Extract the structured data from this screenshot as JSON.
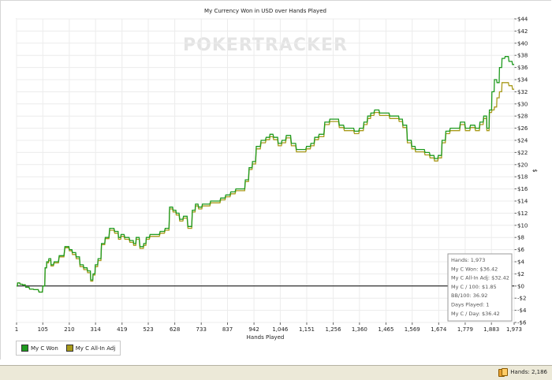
{
  "chart_data": {
    "type": "line",
    "title": "My Currency Won in USD over Hands Played",
    "watermark": "POKERTRACKER",
    "xlabel": "Hands Played",
    "ylabel": "$",
    "xlim": [
      1,
      1973
    ],
    "ylim": [
      -6,
      44
    ],
    "x_ticks": [
      "1",
      "105",
      "210",
      "314",
      "419",
      "523",
      "628",
      "733",
      "837",
      "942",
      "1,046",
      "1,151",
      "1,256",
      "1,360",
      "1,465",
      "1,569",
      "1,674",
      "1,779",
      "1,883",
      "1,973"
    ],
    "y_ticks": [
      "-$6",
      "-$4",
      "-$2",
      "$0",
      "$2",
      "$4",
      "$6",
      "$8",
      "$10",
      "$12",
      "$14",
      "$16",
      "$18",
      "$20",
      "$22",
      "$24",
      "$26",
      "$28",
      "$30",
      "$32",
      "$34",
      "$36",
      "$38",
      "$40",
      "$42",
      "$44"
    ],
    "grid": true,
    "legend_position": "bottom-left",
    "series": [
      {
        "name": "My C Won",
        "color": "#1e9a1e",
        "x": [
          1,
          10,
          20,
          30,
          45,
          60,
          80,
          100,
          110,
          118,
          123,
          135,
          140,
          160,
          180,
          205,
          215,
          230,
          245,
          260,
          275,
          290,
          300,
          308,
          318,
          330,
          345,
          360,
          380,
          400,
          410,
          420,
          440,
          460,
          470,
          480,
          500,
          510,
          520,
          540,
          560,
          580,
          600,
          615,
          628,
          640,
          655,
          670,
          690,
          705,
          715,
          730,
          745,
          760,
          780,
          800,
          820,
          840,
          860,
          880,
          900,
          915,
          930,
          942,
          960,
          980,
          1000,
          1010,
          1030,
          1046,
          1060,
          1080,
          1100,
          1120,
          1140,
          1160,
          1175,
          1190,
          1210,
          1235,
          1250,
          1270,
          1290,
          1310,
          1330,
          1350,
          1370,
          1385,
          1400,
          1410,
          1430,
          1450,
          1470,
          1490,
          1510,
          1525,
          1540,
          1560,
          1575,
          1590,
          1610,
          1630,
          1650,
          1665,
          1680,
          1695,
          1710,
          1730,
          1750,
          1770,
          1790,
          1810,
          1830,
          1845,
          1860,
          1870,
          1880,
          1890,
          1900,
          1910,
          1920,
          1930,
          1945,
          1960,
          1973
        ],
        "y": [
          0,
          0.5,
          0.3,
          0.2,
          -0.2,
          -0.5,
          -0.6,
          -1,
          0,
          3,
          4,
          4.5,
          3.5,
          4,
          5,
          6.5,
          6,
          5.5,
          4.8,
          3.5,
          3,
          2.5,
          1,
          2,
          3.5,
          4.5,
          7,
          8,
          9.5,
          9,
          8,
          8.5,
          8,
          7.5,
          7,
          8,
          6.5,
          7,
          8,
          8.5,
          8.5,
          9,
          9.5,
          13,
          12.5,
          12,
          11,
          11.5,
          9.8,
          12.5,
          13.5,
          13,
          13.5,
          13.5,
          14,
          14,
          14.5,
          15,
          15.5,
          16,
          16,
          17.5,
          19.5,
          20.5,
          23,
          24,
          24.5,
          25,
          24.5,
          23.5,
          24,
          24.8,
          23.5,
          22.5,
          22.5,
          23,
          23.5,
          24.5,
          25,
          27,
          27.5,
          27.5,
          26.5,
          26,
          26,
          25.5,
          26,
          27,
          28,
          28.5,
          29,
          28.5,
          28.5,
          28,
          28,
          27.5,
          26.5,
          24,
          23,
          22.5,
          22.5,
          22,
          21.5,
          21,
          21.5,
          24,
          25.5,
          26,
          26,
          27,
          26,
          26.5,
          26,
          27,
          28,
          26,
          29,
          32,
          34,
          33.5,
          36,
          37.5,
          37.8,
          37,
          36.5
        ]
      },
      {
        "name": "My C All-In Adj",
        "color": "#a89a1a",
        "x": [
          1,
          10,
          20,
          30,
          45,
          60,
          80,
          100,
          110,
          118,
          123,
          135,
          140,
          160,
          180,
          205,
          215,
          230,
          245,
          260,
          275,
          290,
          300,
          308,
          318,
          330,
          345,
          360,
          380,
          400,
          410,
          420,
          440,
          460,
          470,
          480,
          500,
          510,
          520,
          540,
          560,
          580,
          600,
          615,
          628,
          640,
          655,
          670,
          690,
          705,
          715,
          730,
          745,
          760,
          780,
          800,
          820,
          840,
          860,
          880,
          900,
          915,
          930,
          942,
          960,
          980,
          1000,
          1010,
          1030,
          1046,
          1060,
          1080,
          1100,
          1120,
          1140,
          1160,
          1175,
          1190,
          1210,
          1235,
          1250,
          1270,
          1290,
          1310,
          1330,
          1350,
          1370,
          1385,
          1400,
          1410,
          1430,
          1450,
          1470,
          1490,
          1510,
          1525,
          1540,
          1560,
          1575,
          1590,
          1610,
          1630,
          1650,
          1665,
          1680,
          1695,
          1710,
          1730,
          1750,
          1770,
          1790,
          1810,
          1830,
          1845,
          1860,
          1870,
          1880,
          1890,
          1900,
          1910,
          1920,
          1930,
          1945,
          1960,
          1973
        ],
        "y": [
          0,
          0.5,
          0.3,
          0.2,
          -0.2,
          -0.5,
          -0.6,
          -1,
          0,
          3,
          3.8,
          4.2,
          3.3,
          3.8,
          4.8,
          6.3,
          5.8,
          5.2,
          4.5,
          3.2,
          2.7,
          2.2,
          0.8,
          1.8,
          3.2,
          4.2,
          6.8,
          7.8,
          9.2,
          8.7,
          7.7,
          8.2,
          7.7,
          7.2,
          6.7,
          7.7,
          6.2,
          6.7,
          7.7,
          8.2,
          8.2,
          8.7,
          9.2,
          12.7,
          12.2,
          11.7,
          10.7,
          11.2,
          9.5,
          12.2,
          13.2,
          12.7,
          13.2,
          13.2,
          13.7,
          13.7,
          14.2,
          14.7,
          15.2,
          15.7,
          15.7,
          17.2,
          19.2,
          20.1,
          22.6,
          23.6,
          24.1,
          24.6,
          24.1,
          23.1,
          23.6,
          24.4,
          23.1,
          22.1,
          22.1,
          22.6,
          23.1,
          24.1,
          24.6,
          26.6,
          27.1,
          27.1,
          26.1,
          25.6,
          25.6,
          25.1,
          25.6,
          26.6,
          27.6,
          28.1,
          28.6,
          28.1,
          28.1,
          27.6,
          27.6,
          27.1,
          26.1,
          23.6,
          22.6,
          22.1,
          22.1,
          21.6,
          21.1,
          20.6,
          21.1,
          23.6,
          25.1,
          25.6,
          25.6,
          26.6,
          25.6,
          26.1,
          25.6,
          26.6,
          27.6,
          25.6,
          28.6,
          29,
          29.5,
          31,
          32,
          33.5,
          33.5,
          33,
          32.42
        ]
      }
    ],
    "zero_line": true,
    "info_box": [
      "Hands: 1,973",
      "My C Won: $36.42",
      "My C All-In Adj: $32.42",
      "My C / 100: $1.85",
      "BB/100: 36.92",
      "Days Played: 1",
      "My C / Day: $36.42"
    ]
  },
  "status_bar": {
    "hands_text": "Hands: 2,186",
    "icon": "cards-icon"
  }
}
